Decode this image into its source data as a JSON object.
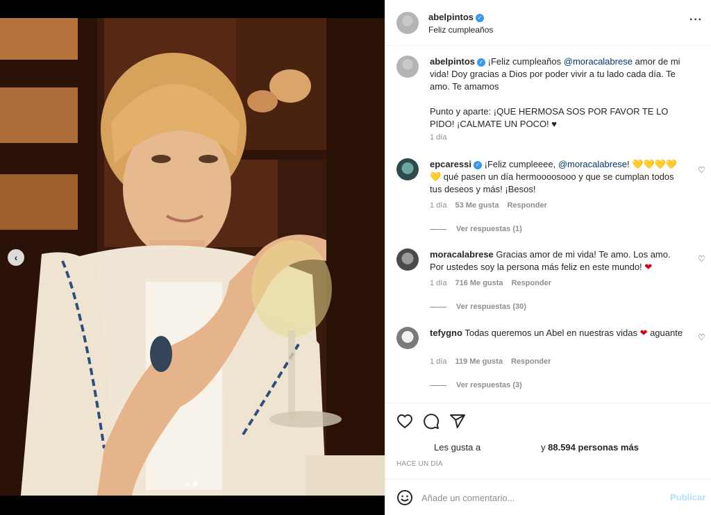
{
  "post": {
    "author": "abelpintos",
    "location": "Feliz cumpleaños",
    "more_icon": "more-options-icon"
  },
  "caption": {
    "author": "abelpintos",
    "text_a": "¡Feliz cumpleaños ",
    "mention": "@moracalabrese",
    "text_b": " amor de mi vida! Doy gracias a Dios por poder vivir a tu lado cada día. Te amo. Te amamos",
    "text_c": "Punto y aparte: ¡QUE HERMOSA SOS POR FAVOR TE LO PIDO! ¡CALMATE UN POCO! ♥",
    "time": "1 día"
  },
  "comments": [
    {
      "author": "epcaressi",
      "text_a": "¡Feliz cumpleeee, ",
      "mention": "@moracalabrese",
      "text_b": "! 💛💛💛💛 💛 qué pasen un día hermoooosooo y que se cumplan todos tus deseos y más! ¡Besos!",
      "time": "1 día",
      "likes": "53 Me gusta",
      "reply": "Responder",
      "view_replies": "Ver respuestas (1)"
    },
    {
      "author": "moracalabrese",
      "text_a": "Gracias amor de mi vida! Te amo. Los amo. Por ustedes soy la persona más feliz en este mundo! ",
      "emoji": "❤",
      "time": "1 día",
      "likes": "716 Me gusta",
      "reply": "Responder",
      "view_replies": "Ver respuestas (30)"
    },
    {
      "author": "tefygno",
      "text_a": "Todas queremos un Abel en nuestras vidas ",
      "emoji": "❤",
      "text_b": " aguante",
      "time": "1 día",
      "likes": "119 Me gusta",
      "reply": "Responder",
      "view_replies": "Ver respuestas (3)"
    }
  ],
  "actions": {
    "likes_prefix": "Les gusta a",
    "likes_suffix_a": "y ",
    "likes_count": "88.594 personas más",
    "ago": "HACE UN DÍA"
  },
  "composer": {
    "placeholder": "Añade un comentario...",
    "publish": "Publicar"
  },
  "colors": {
    "link": "#00376b",
    "verified": "#3897f0",
    "publish_disabled": "#b2dffc"
  }
}
